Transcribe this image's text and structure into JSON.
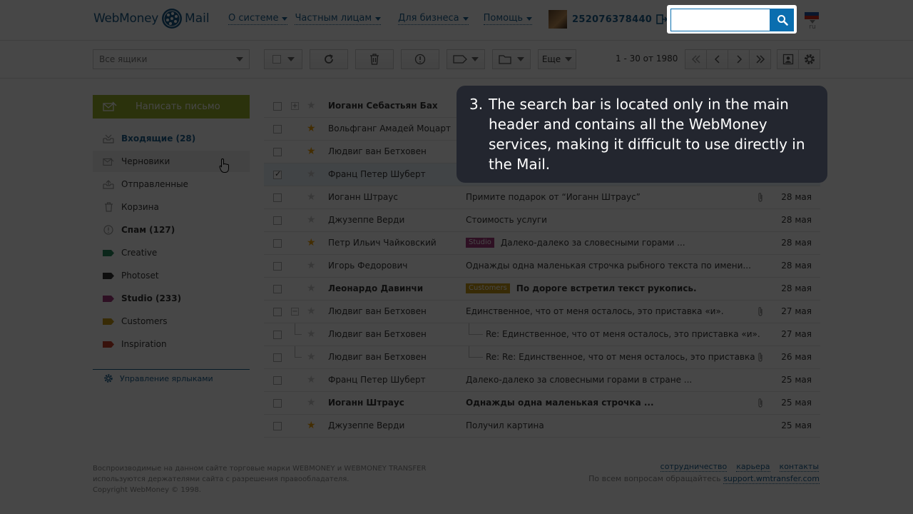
{
  "header": {
    "logo_left": "WebMoney",
    "logo_right": "Mail",
    "nav": [
      "О системе",
      "Частным лицам",
      "Для бизнеса",
      "Помощь"
    ],
    "wmid": "252076378440",
    "search": {
      "value": "",
      "placeholder": ""
    },
    "lang": "ru"
  },
  "toolbar": {
    "folder_select": "Все ящики",
    "more_label": "Еще",
    "pager": "1 - 30 от 1980"
  },
  "sidebar": {
    "compose_label": "Написать письмо",
    "folders": [
      {
        "label": "Входящие (28)"
      },
      {
        "label": "Черновики"
      },
      {
        "label": "Отправленные"
      },
      {
        "label": "Корзина"
      },
      {
        "label": "Спам (127)"
      },
      {
        "label": "Creative",
        "color": "#2a8a5e"
      },
      {
        "label": "Photoset",
        "color": "#333333"
      },
      {
        "label": "Studio (233)",
        "color": "#a43a7e"
      },
      {
        "label": "Customers",
        "color": "#c89a18"
      },
      {
        "label": "Inspiration",
        "color": "#c8412b"
      }
    ],
    "manage_labels": "Управление ярлыками"
  },
  "mails": [
    {
      "sender": "Иоганн Себастьян Бах",
      "subject": "",
      "date": ""
    },
    {
      "sender": "Вольфганг Амадей Моцарт",
      "subject": "",
      "date": ""
    },
    {
      "sender": "Людвиг ван Бетховен",
      "subject": "",
      "date": ""
    },
    {
      "sender": "Франц Петер Шуберт",
      "subject": "",
      "date": ""
    },
    {
      "sender": "Иоганн Штраус",
      "subject": "Примите подарок от “Иоганн Штраус”",
      "date": "28 мая"
    },
    {
      "sender": "Джузеппе Верди",
      "subject": "Стоимость услуги",
      "date": "28 мая"
    },
    {
      "sender": "Петр Ильич Чайковский",
      "label": "Studio",
      "subject": "Далеко-далеко за словесными горами ...",
      "date": "28 мая"
    },
    {
      "sender": "Игорь Федорович",
      "subject": "Однажды одна маленькая строчка рыбного текста по имени...",
      "date": "28 мая"
    },
    {
      "sender": "Леонардо Давинчи",
      "label": "Customers",
      "subject": "По дороге встретил текст рукопись.",
      "date": "28 мая"
    },
    {
      "sender": "Людвиг ван Бетховен",
      "subject": "Единственное, что от меня осталось, это приставка «и».",
      "date": "27 мая"
    },
    {
      "sender": "Людвиг ван Бетховен",
      "subject": "Re: Единственное, что от меня осталось, это приставка «и».",
      "date": "27 мая"
    },
    {
      "sender": "Людвиг ван Бетховен",
      "subject": "Re: Re: Единственное, что от меня осталось, это приставка",
      "date": "26 мая"
    },
    {
      "sender": "Франц Петер Шуберт",
      "subject": "Далеко-далеко за словесными горами в стране ...",
      "date": "25 мая"
    },
    {
      "sender": "Иоганн Штраус",
      "subject": "Однажды одна маленькая строчка ...",
      "date": "25 мая"
    },
    {
      "sender": "Джузеппе Верди",
      "subject": "Получил картина",
      "date": "25 мая"
    }
  ],
  "footer": {
    "line1": "Воспроизводимые на данном сайте торговые марки WEBMONEY и WEBMONEY TRANSFER",
    "line2": "используются держателями сайта с разрешения правообладателя.",
    "line3": "Copyright WebMoney © 1998.",
    "links": [
      "сотрудничество",
      "карьера",
      "контакты"
    ],
    "support_prefix": "По всем вопросам обращайтесь",
    "support_link": "support.wmtransfer.com"
  },
  "tooltip": {
    "number": "3.",
    "text": "The search bar is located only in the main header and contains all the WebMoney services, making it difficult to use directly in the Mail."
  },
  "colors": {
    "accent": "#0a6eaf",
    "compose": "#9cb52d",
    "star_on": "#f0a30a",
    "label_studio": "#a43a7e",
    "label_customers": "#c89a18"
  }
}
